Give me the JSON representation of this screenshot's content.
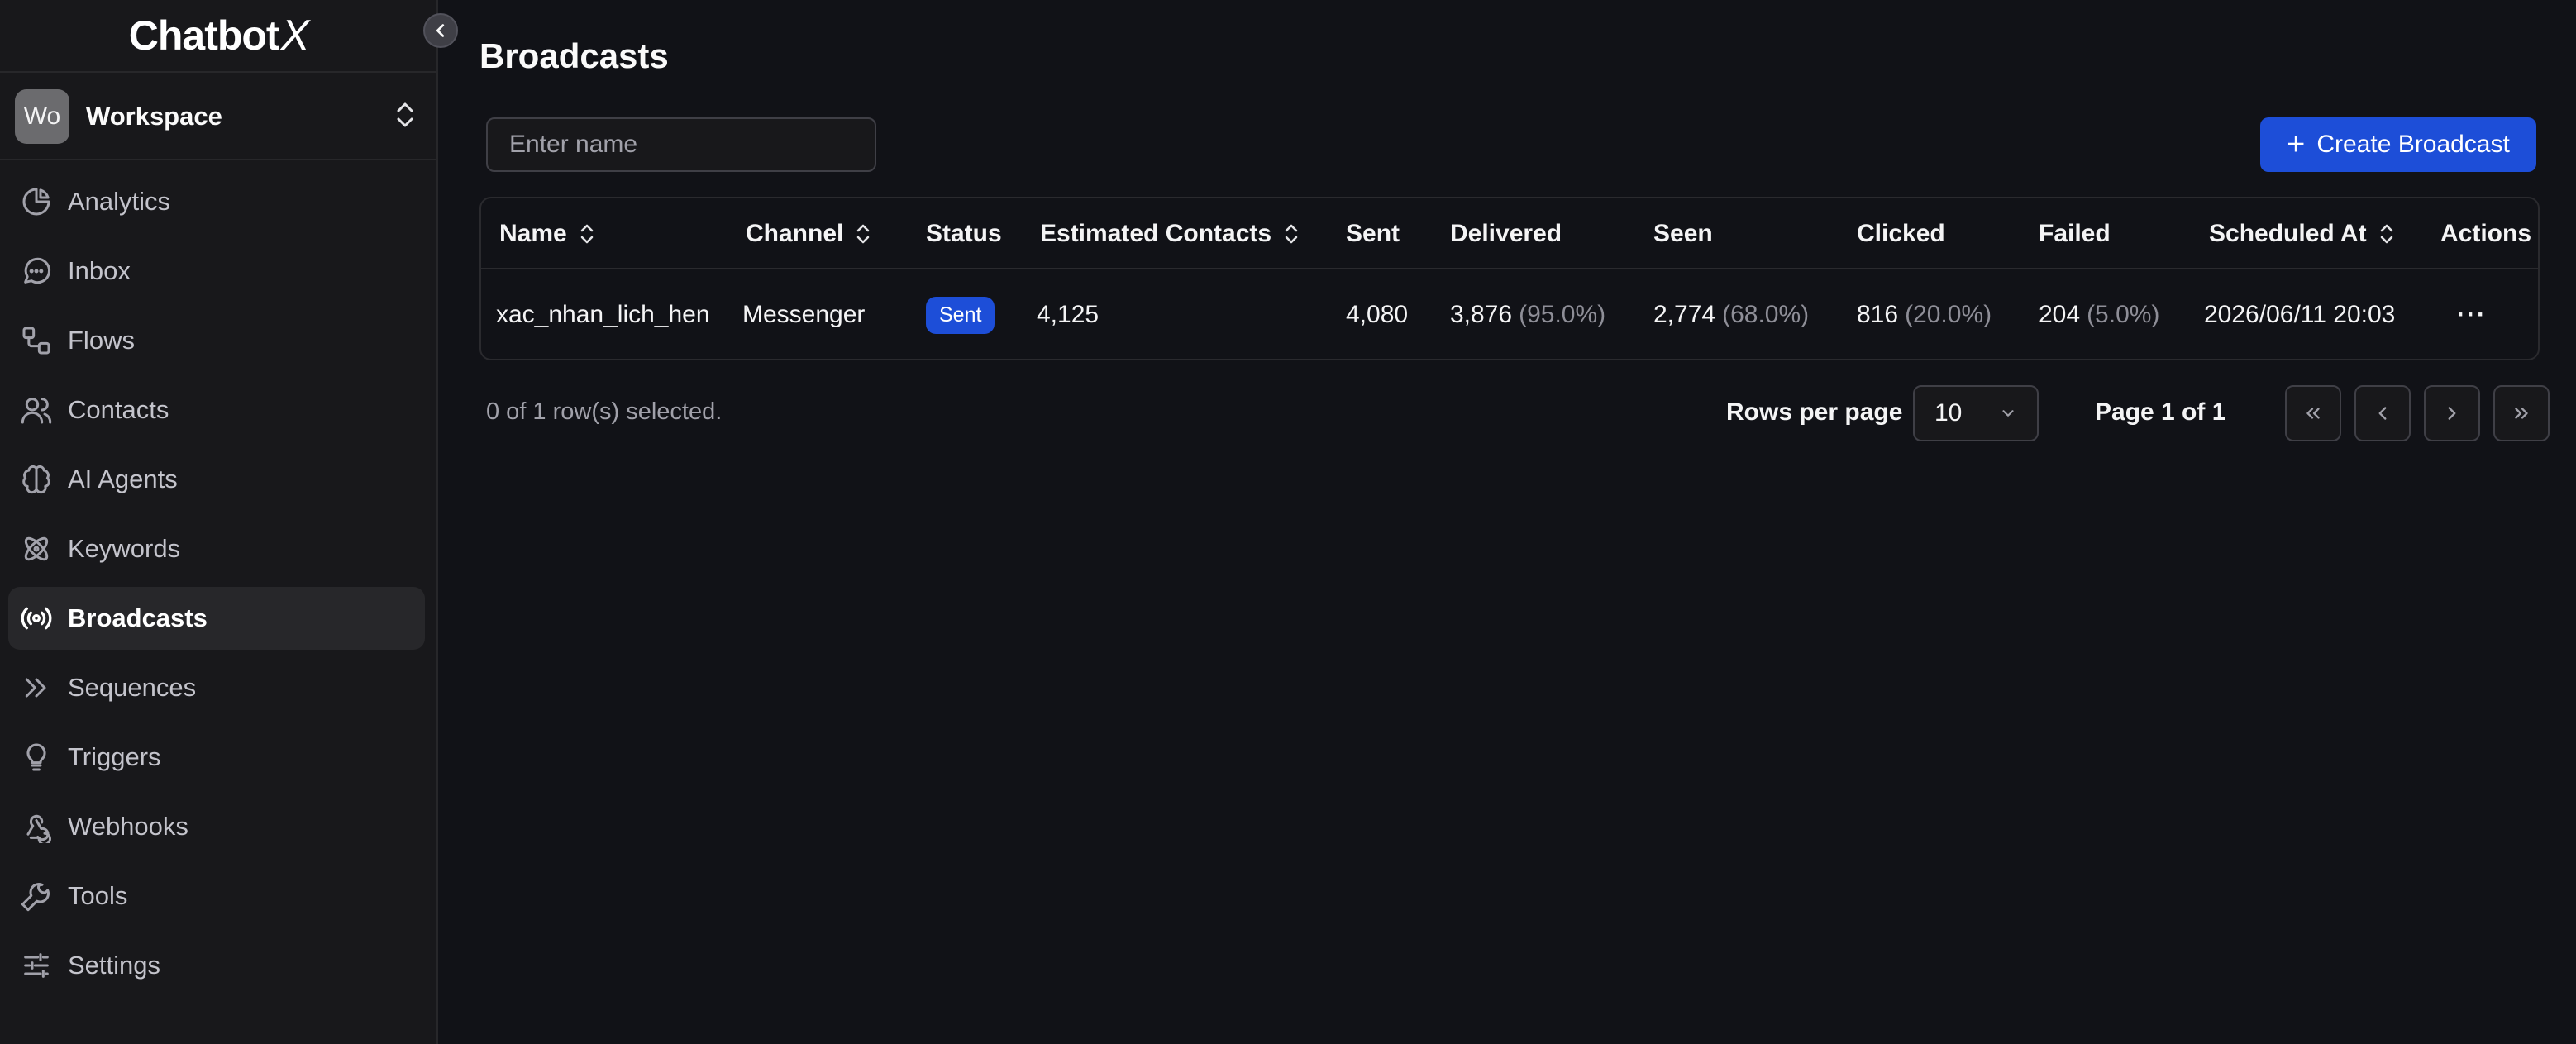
{
  "app": {
    "logo_text": "Chatbot",
    "logo_x": "X"
  },
  "workspace": {
    "avatar": "Wo",
    "name": "Workspace"
  },
  "sidebar": {
    "items": [
      {
        "label": "Analytics",
        "icon": "chart-pie-icon"
      },
      {
        "label": "Inbox",
        "icon": "message-icon"
      },
      {
        "label": "Flows",
        "icon": "flows-icon"
      },
      {
        "label": "Contacts",
        "icon": "users-icon"
      },
      {
        "label": "AI Agents",
        "icon": "brain-icon"
      },
      {
        "label": "Keywords",
        "icon": "atom-icon"
      },
      {
        "label": "Broadcasts",
        "icon": "broadcast-icon",
        "active": true
      },
      {
        "label": "Sequences",
        "icon": "chevrons-right-icon"
      },
      {
        "label": "Triggers",
        "icon": "lightbulb-icon"
      },
      {
        "label": "Webhooks",
        "icon": "webhook-icon"
      },
      {
        "label": "Tools",
        "icon": "wrench-icon"
      },
      {
        "label": "Settings",
        "icon": "sliders-icon"
      }
    ]
  },
  "page": {
    "title": "Broadcasts"
  },
  "search": {
    "placeholder": "Enter name",
    "value": ""
  },
  "toolbar": {
    "create_label": "Create Broadcast"
  },
  "table": {
    "headers": {
      "name": "Name",
      "channel": "Channel",
      "status": "Status",
      "estimated": "Estimated Contacts",
      "sent": "Sent",
      "delivered": "Delivered",
      "seen": "Seen",
      "clicked": "Clicked",
      "failed": "Failed",
      "scheduled": "Scheduled At",
      "actions": "Actions"
    },
    "rows": [
      {
        "name": "xac_nhan_lich_hen",
        "channel": "Messenger",
        "status": "Sent",
        "estimated": "4,125",
        "sent": "4,080",
        "delivered": "3,876",
        "delivered_pct": "(95.0%)",
        "seen": "2,774",
        "seen_pct": "(68.0%)",
        "clicked": "816",
        "clicked_pct": "(20.0%)",
        "failed": "204",
        "failed_pct": "(5.0%)",
        "scheduled": "2026/06/11 20:03",
        "actions": "···"
      }
    ]
  },
  "footer": {
    "selection": "0 of 1 row(s) selected.",
    "rows_per_page_label": "Rows per page",
    "rows_per_page_value": "10",
    "page_label": "Page 1 of 1"
  },
  "colors": {
    "accent": "#1d4ed8",
    "background": "#111217",
    "sidebar": "#18181b"
  }
}
